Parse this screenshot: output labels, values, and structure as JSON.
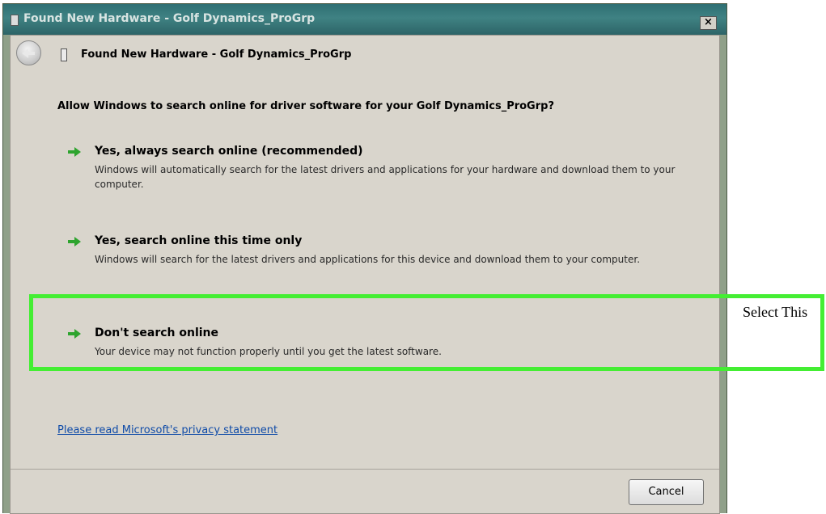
{
  "window": {
    "title": "Found New Hardware - Golf Dynamics_ProGrp",
    "close_label": "×"
  },
  "header": {
    "title": "Found New Hardware - Golf Dynamics_ProGrp"
  },
  "main": {
    "question": "Allow Windows to search online for driver software for your Golf Dynamics_ProGrp?",
    "options": [
      {
        "title": "Yes, always search online (recommended)",
        "description": "Windows will automatically search for the latest drivers and applications for your hardware and download them to your computer."
      },
      {
        "title": "Yes, search online this time only",
        "description": "Windows will search for the latest drivers and applications for this device and download them to your computer."
      },
      {
        "title": "Don't search online",
        "description": "Your device may not function properly until you get the latest software."
      }
    ],
    "privacy_link": "Please read Microsoft's  privacy statement"
  },
  "footer": {
    "cancel_label": "Cancel"
  },
  "annotation": {
    "note": "Select This",
    "highlight_color": "#44ee33"
  },
  "icons": {
    "option_arrow": "green-arrow-icon",
    "back": "back-arrow-icon",
    "hardware": "hardware-icon"
  },
  "colors": {
    "titlebar": "#3f8283",
    "client_bg": "#d9d5cc",
    "link": "#0f4ba8",
    "option_arrow": "#2ea42e"
  }
}
